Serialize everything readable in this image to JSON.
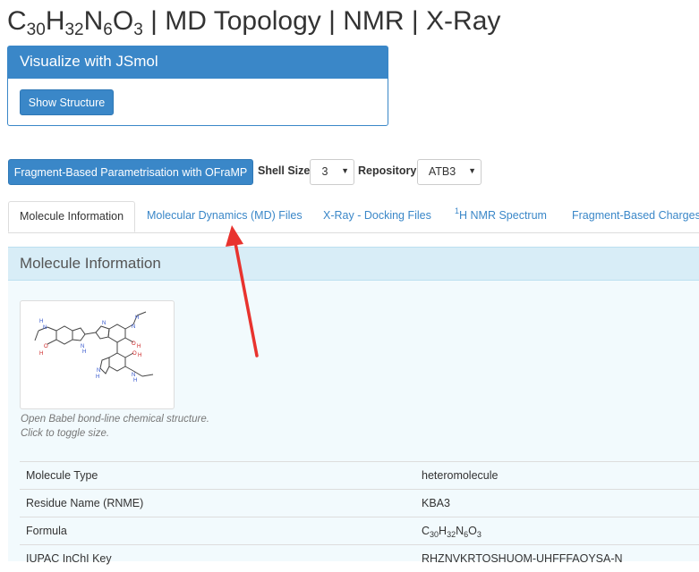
{
  "title": {
    "formula": [
      "C",
      "30",
      "H",
      "32",
      "N",
      "6",
      "O",
      "3"
    ],
    "rest": " | MD Topology | NMR | X-Ray"
  },
  "jsmol": {
    "heading": "Visualize with JSmol",
    "button": "Show Structure"
  },
  "controls": {
    "ofraMP_button": "Fragment-Based Parametrisation with OFraMP",
    "shell_label": "Shell Size",
    "shell_value": "3",
    "repo_label": "Repository",
    "repo_value": "ATB3"
  },
  "tabs": [
    {
      "label": "Molecule Information"
    },
    {
      "label": "Molecular Dynamics (MD) Files"
    },
    {
      "label": "X-Ray - Docking Files"
    },
    {
      "sup": "1",
      "label": "H NMR Spectrum"
    },
    {
      "label": "Fragment-Based Charges"
    }
  ],
  "section": {
    "heading": "Molecule Information",
    "caption_line1": "Open Babel bond-line chemical structure.",
    "caption_line2": "Click to toggle size."
  },
  "table": [
    {
      "label": "Molecule Type",
      "value": "heteromolecule"
    },
    {
      "label": "Residue Name (RNME)",
      "value": "KBA3"
    },
    {
      "label": "Formula",
      "formula": [
        "C",
        "30",
        "H",
        "32",
        "N",
        "6",
        "O",
        "3"
      ]
    },
    {
      "label": "IUPAC InChI Key",
      "value": "RHZNVKRTOSHUOM-UHFFFAOYSA-N"
    }
  ],
  "colors": {
    "primary": "#3a87c8",
    "panel_heading_bg": "#d8edf7",
    "content_bg": "#f2fafd",
    "annotation_arrow": "#e8332e"
  },
  "icons": {
    "select_caret": "▼"
  }
}
